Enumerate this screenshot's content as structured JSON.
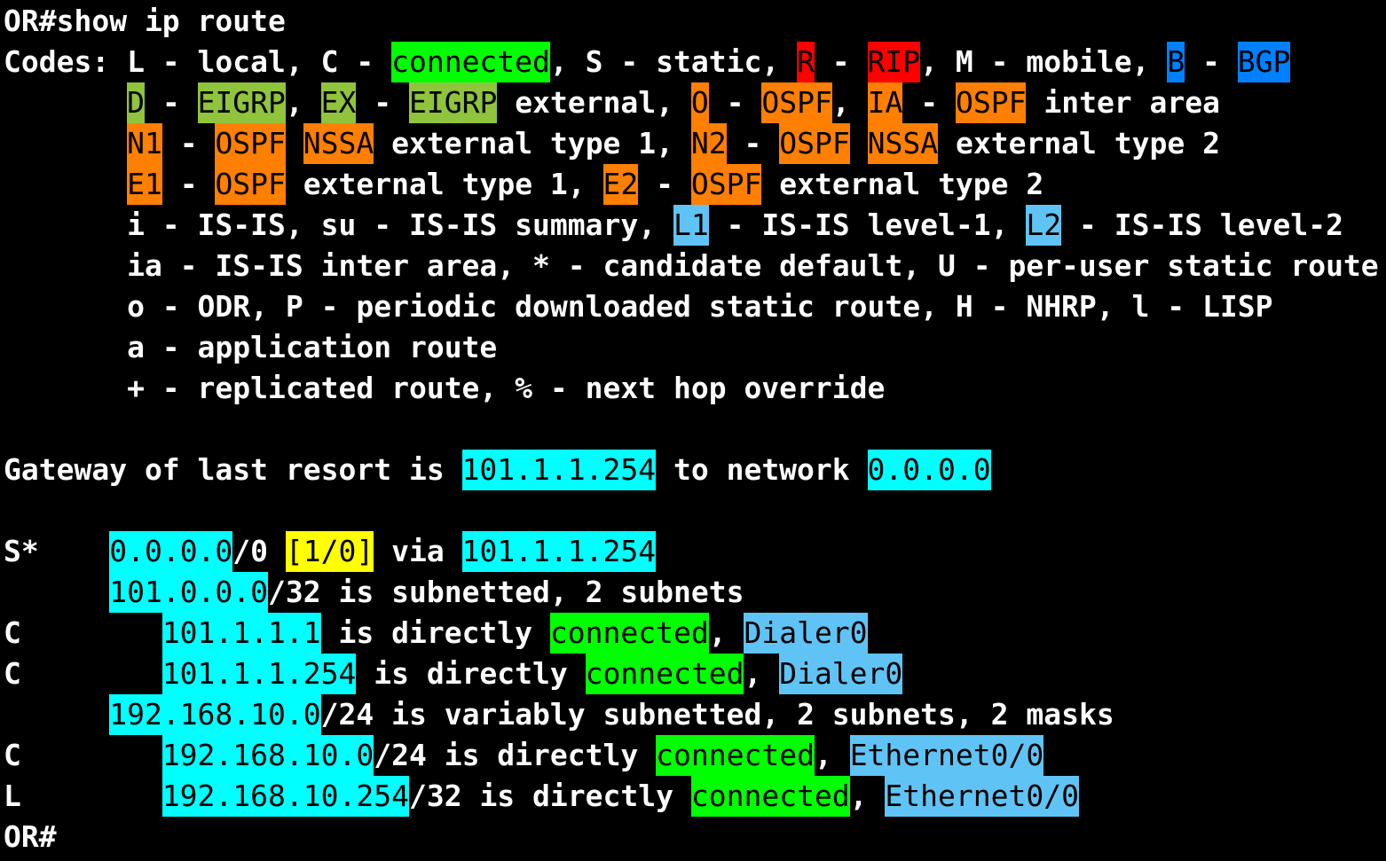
{
  "colors": {
    "background": "#000000",
    "text": "#ffffff",
    "green": "#00ff00",
    "red": "#ff0000",
    "blue": "#0080ff",
    "olive": "#8fc43c",
    "orange": "#ff7f00",
    "ltblue": "#5fc4f5",
    "cyan": "#00ffff",
    "yellow": "#ffff00"
  },
  "terminal": {
    "lines": [
      [
        {
          "t": "OR#show ip route"
        }
      ],
      [
        {
          "t": "Codes: L - local, C - "
        },
        {
          "t": "connected",
          "c": "green"
        },
        {
          "t": ", S - static, "
        },
        {
          "t": "R",
          "c": "red"
        },
        {
          "t": " - "
        },
        {
          "t": "RIP",
          "c": "red"
        },
        {
          "t": ", M - mobile, "
        },
        {
          "t": "B",
          "c": "blue"
        },
        {
          "t": " - "
        },
        {
          "t": "BGP",
          "c": "blue"
        }
      ],
      [
        {
          "t": "       "
        },
        {
          "t": "D",
          "c": "olive"
        },
        {
          "t": " - "
        },
        {
          "t": "EIGRP",
          "c": "olive"
        },
        {
          "t": ", "
        },
        {
          "t": "EX",
          "c": "olive"
        },
        {
          "t": " - "
        },
        {
          "t": "EIGRP",
          "c": "olive"
        },
        {
          "t": " external, "
        },
        {
          "t": "O",
          "c": "orange"
        },
        {
          "t": " - "
        },
        {
          "t": "OSPF",
          "c": "orange"
        },
        {
          "t": ", "
        },
        {
          "t": "IA",
          "c": "orange"
        },
        {
          "t": " - "
        },
        {
          "t": "OSPF",
          "c": "orange"
        },
        {
          "t": " inter area"
        }
      ],
      [
        {
          "t": "       "
        },
        {
          "t": "N1",
          "c": "orange"
        },
        {
          "t": " - "
        },
        {
          "t": "OSPF",
          "c": "orange"
        },
        {
          "t": " "
        },
        {
          "t": "NSSA",
          "c": "orange"
        },
        {
          "t": " external type 1, "
        },
        {
          "t": "N2",
          "c": "orange"
        },
        {
          "t": " - "
        },
        {
          "t": "OSPF",
          "c": "orange"
        },
        {
          "t": " "
        },
        {
          "t": "NSSA",
          "c": "orange"
        },
        {
          "t": " external type 2"
        }
      ],
      [
        {
          "t": "       "
        },
        {
          "t": "E1",
          "c": "orange"
        },
        {
          "t": " - "
        },
        {
          "t": "OSPF",
          "c": "orange"
        },
        {
          "t": " external type 1, "
        },
        {
          "t": "E2",
          "c": "orange"
        },
        {
          "t": " - "
        },
        {
          "t": "OSPF",
          "c": "orange"
        },
        {
          "t": " external type 2"
        }
      ],
      [
        {
          "t": "       i - IS-IS, su - IS-IS summary, "
        },
        {
          "t": "L1",
          "c": "ltblue"
        },
        {
          "t": " - IS-IS level-1, "
        },
        {
          "t": "L2",
          "c": "ltblue"
        },
        {
          "t": " - IS-IS level-2"
        }
      ],
      [
        {
          "t": "       ia - IS-IS inter area, * - candidate default, U - per-user static route"
        }
      ],
      [
        {
          "t": "       o - ODR, P - periodic downloaded static route, H - NHRP, l - LISP"
        }
      ],
      [
        {
          "t": "       a - application route"
        }
      ],
      [
        {
          "t": "       + - replicated route, % - next hop override"
        }
      ],
      [
        {
          "t": ""
        }
      ],
      [
        {
          "t": "Gateway of last resort is "
        },
        {
          "t": "101.1.1.254",
          "c": "cyan"
        },
        {
          "t": " to network "
        },
        {
          "t": "0.0.0.0",
          "c": "cyan"
        }
      ],
      [
        {
          "t": ""
        }
      ],
      [
        {
          "t": "S*    "
        },
        {
          "t": "0.0.0.0",
          "c": "cyan"
        },
        {
          "t": "/0 "
        },
        {
          "t": "[1/0]",
          "c": "yellow"
        },
        {
          "t": " via "
        },
        {
          "t": "101.1.1.254",
          "c": "cyan"
        }
      ],
      [
        {
          "t": "      "
        },
        {
          "t": "101.0.0.0",
          "c": "cyan"
        },
        {
          "t": "/32 is subnetted, 2 subnets"
        }
      ],
      [
        {
          "t": "C        "
        },
        {
          "t": "101.1.1.1",
          "c": "cyan"
        },
        {
          "t": " is directly "
        },
        {
          "t": "connected",
          "c": "green"
        },
        {
          "t": ", "
        },
        {
          "t": "Dialer0",
          "c": "ltblue"
        }
      ],
      [
        {
          "t": "C        "
        },
        {
          "t": "101.1.1.254",
          "c": "cyan"
        },
        {
          "t": " is directly "
        },
        {
          "t": "connected",
          "c": "green"
        },
        {
          "t": ", "
        },
        {
          "t": "Dialer0",
          "c": "ltblue"
        }
      ],
      [
        {
          "t": "      "
        },
        {
          "t": "192.168.10.0",
          "c": "cyan"
        },
        {
          "t": "/24 is variably subnetted, 2 subnets, 2 masks"
        }
      ],
      [
        {
          "t": "C        "
        },
        {
          "t": "192.168.10.0",
          "c": "cyan"
        },
        {
          "t": "/24 is directly "
        },
        {
          "t": "connected",
          "c": "green"
        },
        {
          "t": ", "
        },
        {
          "t": "Ethernet0/0",
          "c": "ltblue"
        }
      ],
      [
        {
          "t": "L        "
        },
        {
          "t": "192.168.10.254",
          "c": "cyan"
        },
        {
          "t": "/32 is directly "
        },
        {
          "t": "connected",
          "c": "green"
        },
        {
          "t": ", "
        },
        {
          "t": "Ethernet0/0",
          "c": "ltblue"
        }
      ],
      [
        {
          "t": "OR#"
        }
      ]
    ]
  }
}
